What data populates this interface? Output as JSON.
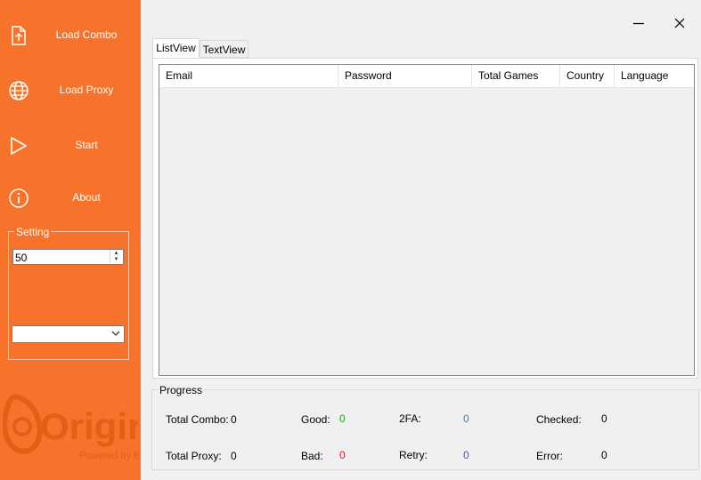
{
  "sidebar": {
    "items": [
      {
        "label": "Load Combo",
        "icon": "upload-file-icon"
      },
      {
        "label": "Load Proxy",
        "icon": "globe-icon"
      },
      {
        "label": "Start",
        "icon": "play-icon"
      },
      {
        "label": "About",
        "icon": "info-icon"
      }
    ],
    "setting": {
      "legend": "Setting",
      "threads_value": "50",
      "dropdown_value": ""
    },
    "logo": {
      "brand": "Origin",
      "tagline": "Powered by EA"
    },
    "background_color": "#f7722a"
  },
  "tabs": [
    {
      "label": "ListView",
      "active": true
    },
    {
      "label": "TextView",
      "active": false
    }
  ],
  "listview": {
    "columns": [
      "Email",
      "Password",
      "Total Games",
      "Country",
      "Language"
    ],
    "rows": []
  },
  "progress": {
    "legend": "Progress",
    "total_combo": {
      "label": "Total Combo:",
      "value": "0"
    },
    "total_proxy": {
      "label": "Total Proxy:",
      "value": "0"
    },
    "good": {
      "label": "Good:",
      "value": "0",
      "color": "#1e9e1e"
    },
    "bad": {
      "label": "Bad:",
      "value": "0",
      "color": "#e02020"
    },
    "twofa": {
      "label": "2FA:",
      "value": "0",
      "color": "#3a86d8"
    },
    "retry": {
      "label": "Retry:",
      "value": "0",
      "color": "#7a3ad8"
    },
    "checked": {
      "label": "Checked:",
      "value": "0"
    },
    "error": {
      "label": "Error:",
      "value": "0"
    }
  }
}
